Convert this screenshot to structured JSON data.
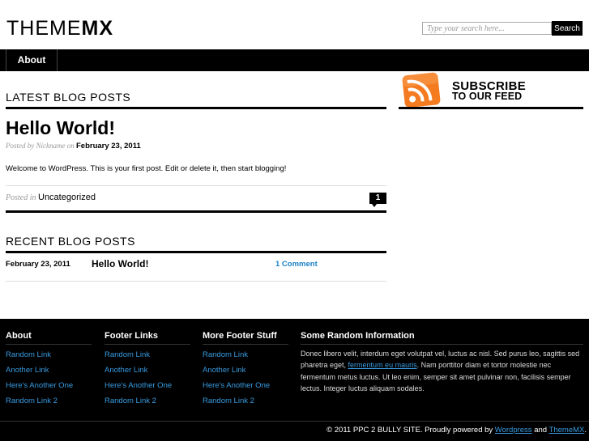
{
  "header": {
    "logo_light": "THEME",
    "logo_bold": "MX",
    "search_placeholder": "Type your search here...",
    "search_button": "Search"
  },
  "nav": {
    "items": [
      {
        "label": "About"
      }
    ]
  },
  "latest": {
    "heading": "LATEST BLOG POSTS",
    "post": {
      "title": "Hello World!",
      "meta_prefix": "Posted by Nickname on",
      "date": "February 23, 2011",
      "body": "Welcome to WordPress. This is your first post. Edit or delete it, then start blogging!",
      "posted_in": "Posted in",
      "category": "Uncategorized",
      "comment_count": "1"
    }
  },
  "recent": {
    "heading": "RECENT BLOG POSTS",
    "items": [
      {
        "date": "February 23, 2011",
        "title": "Hello World!",
        "comments": "1 Comment"
      }
    ]
  },
  "sidebar": {
    "subscribe_line1": "SUBSCRIBE",
    "subscribe_line2": "TO OUR FEED",
    "colors": {
      "rss_orange": "#f47b20"
    }
  },
  "footer": {
    "columns": [
      {
        "heading": "About",
        "links": [
          "Random Link",
          "Another Link",
          "Here's Another One",
          "Random Link 2"
        ]
      },
      {
        "heading": "Footer Links",
        "links": [
          "Random Link",
          "Another Link",
          "Here's Another One",
          "Random Link 2"
        ]
      },
      {
        "heading": "More Footer Stuff",
        "links": [
          "Random Link",
          "Another Link",
          "Here's Another One",
          "Random Link 2"
        ]
      }
    ],
    "random": {
      "heading": "Some Random Information",
      "text_before": "Donec libero velit, interdum eget volutpat vel, luctus ac nisl. Sed purus leo, sagittis sed pharetra eget, ",
      "link": "fermentum eu mauris",
      "text_after": ". Nam porttitor diam et tortor molestie nec fermentum metus luctus. Ut leo enim, semper sit amet pulvinar non, facilisis semper lectus. Integer luctus aliquam sodales."
    },
    "copyright_text": "© 2011 PPC 2 BULLY SITE. Proudly powered by",
    "copyright_link1": "Wordpress",
    "copyright_and": "and",
    "copyright_link2": "ThemeMX",
    "copyright_end": "."
  }
}
